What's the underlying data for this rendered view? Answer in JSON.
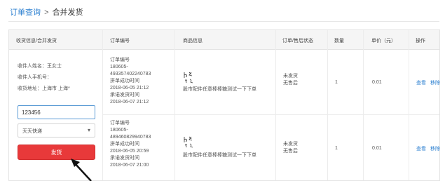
{
  "breadcrumb": {
    "parent": "订单查询",
    "separator": ">",
    "current": "合并发货"
  },
  "table": {
    "headers": [
      "收货信息/合并发货",
      "订单编号",
      "商品信息",
      "订单/售后状态",
      "数量",
      "单价（元）",
      "操作"
    ]
  },
  "recipient": {
    "name_line": "收件人姓名：王女士",
    "phone_line": "收件人手机号：",
    "address_line": "收货地址：上海市 上海*",
    "phone_value": "123456",
    "courier": "天天快递",
    "ship_button": "发货"
  },
  "orders": [
    {
      "lines": [
        "订单编号",
        "180605-",
        "493357402240783",
        "拼单成功时间",
        "2018-06-05 21:12",
        "承诺发货时间",
        "2018-06-07 21:12"
      ],
      "product": "股市配件任意棒棒糖测试一下下单",
      "status": [
        "未发货",
        "无售后"
      ],
      "qty": "1",
      "price": "0.01",
      "actions": [
        "查看",
        "移除"
      ]
    },
    {
      "lines": [
        "订单编号",
        "180605-",
        "489460829940783",
        "拼单成功时间",
        "2018-06-05 20:59",
        "承诺发货时间",
        "2018-06-07 21:00"
      ],
      "product": "股市配件任意棒棒糖测试一下下单",
      "status": [
        "未发货",
        "无售后"
      ],
      "qty": "1",
      "price": "0.01",
      "actions": [
        "查看",
        "移除"
      ]
    }
  ]
}
